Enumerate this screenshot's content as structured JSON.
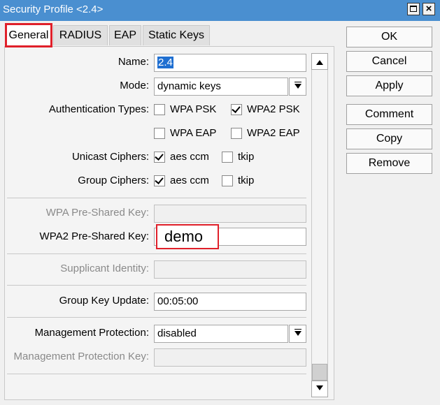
{
  "window": {
    "title": "Security Profile <2.4>"
  },
  "tabs": [
    {
      "label": "General"
    },
    {
      "label": "RADIUS"
    },
    {
      "label": "EAP"
    },
    {
      "label": "Static Keys"
    }
  ],
  "form": {
    "name_label": "Name:",
    "name_value": "2.4",
    "mode_label": "Mode:",
    "mode_value": "dynamic keys",
    "auth_label": "Authentication Types:",
    "auth": {
      "wpa_psk": "WPA PSK",
      "wpa2_psk": "WPA2 PSK",
      "wpa_eap": "WPA EAP",
      "wpa2_eap": "WPA2 EAP"
    },
    "unicast_label": "Unicast Ciphers:",
    "group_label": "Group Ciphers:",
    "cipher": {
      "aes": "aes ccm",
      "tkip": "tkip"
    },
    "wpa_psk_key_label": "WPA Pre-Shared Key:",
    "wpa2_psk_key_label": "WPA2 Pre-Shared Key:",
    "wpa2_psk_key_value": "demo",
    "supplicant_label": "Supplicant Identity:",
    "group_key_label": "Group Key Update:",
    "group_key_value": "00:05:00",
    "mgmt_prot_label": "Management Protection:",
    "mgmt_prot_value": "disabled",
    "mgmt_key_label": "Management Protection Key:"
  },
  "buttons": {
    "ok": "OK",
    "cancel": "Cancel",
    "apply": "Apply",
    "comment": "Comment",
    "copy": "Copy",
    "remove": "Remove"
  },
  "checks": {
    "wpa_psk": false,
    "wpa2_psk": true,
    "wpa_eap": false,
    "wpa2_eap": false,
    "unicast_aes": true,
    "unicast_tkip": false,
    "group_aes": true,
    "group_tkip": false
  },
  "colors": {
    "titlebar": "#4a8fd0",
    "highlight": "#e0202a",
    "selection": "#1f6fd1"
  }
}
